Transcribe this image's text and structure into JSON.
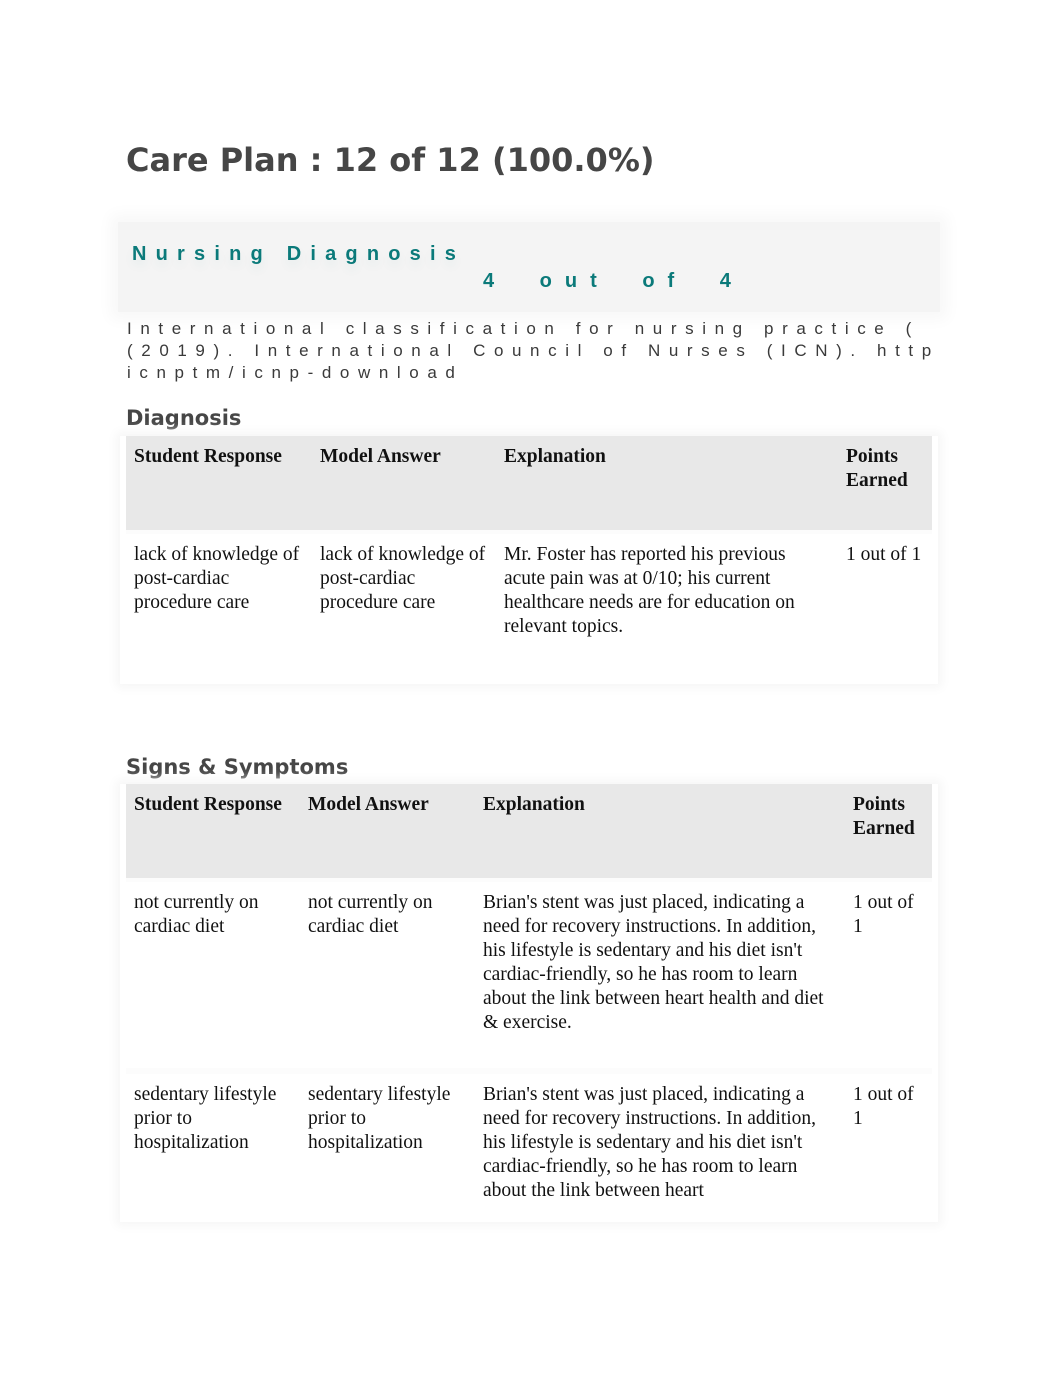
{
  "page": {
    "title": "Care Plan : 12 of 12 (100.0%)"
  },
  "banner": {
    "title": "Nursing Diagnosis",
    "score": "4 out of 4",
    "accent_color": "#0b7a7a"
  },
  "citation": {
    "lines": [
      "International classification for nursing practice (",
      "(2019). International Council of Nurses (ICN). http",
      "icnptm/icnp-download"
    ]
  },
  "sections": [
    {
      "heading": "Diagnosis",
      "columns": [
        "Student Response",
        "Model Answer",
        "Explanation",
        "Points Earned"
      ],
      "rows": [
        {
          "student_response": "lack of knowledge of post-cardiac procedure care",
          "model_answer": "lack of knowledge of post-cardiac procedure care",
          "explanation": "Mr. Foster has reported his previous acute pain was at 0/10; his current healthcare needs are for education on relevant topics.",
          "points": "1 out of 1"
        }
      ]
    },
    {
      "heading": "Signs & Symptoms",
      "columns": [
        "Student Response",
        "Model Answer",
        "Explanation",
        "Points Earned"
      ],
      "rows": [
        {
          "student_response": "not currently on cardiac diet",
          "model_answer": "not currently on cardiac diet",
          "explanation": "Brian's stent was just placed, indicating a need for recovery instructions. In addition, his lifestyle is sedentary and his diet isn't cardiac-friendly, so he has room to learn about the link between heart health and diet & exercise.",
          "points": "1 out of 1"
        },
        {
          "student_response": "sedentary lifestyle prior to hospitalization",
          "model_answer": "sedentary lifestyle prior to hospitalization",
          "explanation": "Brian's stent was just placed, indicating a need for recovery instructions. In addition, his lifestyle is sedentary and his diet isn't cardiac-friendly, so he has room to learn about the link between heart",
          "points": "1 out of 1"
        }
      ]
    }
  ]
}
